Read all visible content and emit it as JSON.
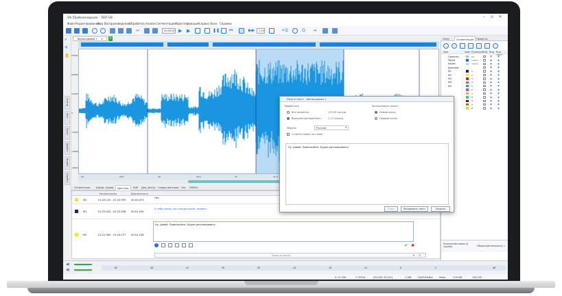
{
  "window": {
    "title": "SIS (Пробная версия) – TEST EN"
  },
  "menu": [
    "Файл",
    "Редактирование",
    "Вид",
    "Воспроизведение",
    "Обработка",
    "Анализ",
    "Сегментация",
    "Идентификация",
    "Сервис",
    "Окна",
    "Справка"
  ],
  "toolbar": {
    "time_field": "00:00:00",
    "speed_field": "1.00",
    "accent": "#1b84d8"
  },
  "document": {
    "tab": "Фонограмма 1"
  },
  "left_tabs": [
    "Спектр",
    "Иэсл",
    "Оуэлл",
    "Двойно",
    "Индекс",
    "Атрибут"
  ],
  "waveform": {
    "color": "#1a95e0",
    "y_ticks": [
      "30000",
      "20000",
      "10000",
      "0",
      "-10000",
      "-20000",
      "-30000"
    ],
    "x_ticks": [
      "29",
      "29.5",
      "30",
      "30.5",
      "31",
      "31.5",
      "32",
      "32.5",
      "33"
    ]
  },
  "segment_tabs": [
    "Сегментные",
    "Шумы",
    "Шумы",
    "Дикторы",
    "КАР",
    "Для_АвтСр",
    "Следы монтажа",
    "Чат",
    "СМЕСЬ"
  ],
  "segment_table": {
    "headers": [
      "",
      "",
      "Начало-конец",
      "Длительность",
      ""
    ],
    "rows": [
      {
        "color": "#ffe600",
        "speaker": "M2",
        "range": "01:20:120 - 01:20:595",
        "duration": "00:00.474",
        "text": "Нет."
      },
      {
        "color": "#1a1aa0",
        "speaker": "M1",
        "range": "01:20:542 - 01:22:038",
        "duration": "00:01.495",
        "text": "А тебя прямо так специальный человек."
      },
      {
        "color": "#ffe600",
        "speaker": "M2",
        "range": "01:22:069 - 01:24:217",
        "duration": "00:02.158",
        "text": "Ну, давай. Приезжайте. Будем разговаривать."
      }
    ],
    "search_placeholder": "Поиск в тексте"
  },
  "right_panel": {
    "tabs": [
      "Окна",
      "Сегментация",
      "Проекты"
    ],
    "headers": [
      "Имя",
      "Цвет",
      "Клавиша",
      "Выб.",
      "Вид.",
      "Вид. текст"
    ],
    "rows": [
      {
        "name": "Однотон...",
        "color": "#7fd0e6",
        "key": "Inc"
      },
      {
        "name": "Звуки",
        "color": "#2b6ed6",
        "key": "<нет>"
      },
      {
        "name": "Шумы",
        "color": "#a8d5f5",
        "key": "<нет>"
      },
      {
        "name": "Дикторы",
        "color": "#ffffff",
        "key": ""
      },
      {
        "name": "M1",
        "color": "#1a1aa0",
        "key": "1"
      },
      {
        "name": "M2",
        "color": "#ffe600",
        "key": "2"
      },
      {
        "name": "Ж1",
        "color": "#d62020",
        "key": "3"
      },
      {
        "name": "Ж2",
        "color": "#e040c0",
        "key": "4"
      },
      {
        "name": "М3",
        "color": "#20b040",
        "key": "5"
      },
      {
        "name": "",
        "color": "#c040e0",
        "key": "6"
      },
      {
        "name": "",
        "color": "#ffa500",
        "key": "7"
      },
      {
        "name": "",
        "color": "#30c0c0",
        "key": "8"
      },
      {
        "name": "",
        "color": "#800000",
        "key": "9"
      },
      {
        "name": "",
        "color": "#808000",
        "key": "0"
      },
      {
        "name": "",
        "color": "#e0e000",
        "key": "Z"
      }
    ],
    "footer_left": "Количество марок (в группе)",
    "footer_right": "Общая длительность, с"
  },
  "dialog": {
    "title": "Речь в текст - Фонограмма 1",
    "processing_label": "Обработать",
    "range_label": "Все разметки",
    "range_value": "170.30 секунд",
    "selected_label": "Выделенный фрагмент",
    "selected_value": "2.17 секунд",
    "channel_label": "Использовать канал",
    "left_channel": "Левый канал",
    "right_channel": "Правый канал",
    "model_label": "Модель",
    "model_value": "Русская",
    "marks_label": "Ставить марки на слова",
    "text": "Ну, давай. Приезжайте. Будем разговаривать.",
    "btn_start": "Старт",
    "btn_copy": "Копировать текст",
    "btn_close": "Закрыть"
  },
  "bottom": {
    "ticks": [
      "-60",
      "-48",
      "-42",
      "-36",
      "-30",
      "-24",
      "-18",
      "-12",
      "-6",
      "0",
      "dB"
    ],
    "status": [
      "X: 31.290",
      "Y: 32254",
      "[32.049; 34.215]",
      "2.166",
      "11025/16-бит",
      "Моно",
      "3.29 Мб",
      "128.218"
    ]
  }
}
